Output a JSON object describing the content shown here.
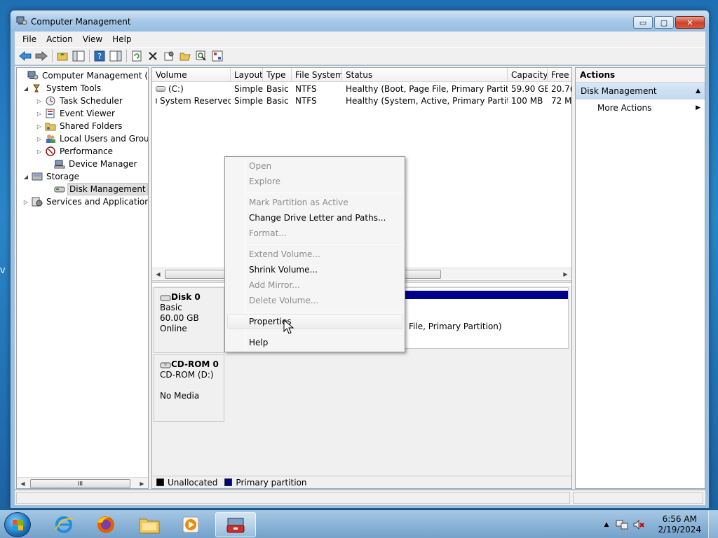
{
  "window": {
    "title": "Computer Management",
    "controls": {
      "minimize": "▭",
      "maximize": "▢",
      "close": "✕"
    }
  },
  "menu": [
    "File",
    "Action",
    "View",
    "Help"
  ],
  "tree": {
    "items": [
      {
        "label": "Computer Management (Local",
        "arrow": "",
        "icon": "computer-management-icon"
      },
      {
        "label": "System Tools",
        "arrow": "◢",
        "icon": "system-tools-icon"
      },
      {
        "label": "Task Scheduler",
        "arrow": "▷",
        "icon": "task-scheduler-icon"
      },
      {
        "label": "Event Viewer",
        "arrow": "▷",
        "icon": "event-viewer-icon"
      },
      {
        "label": "Shared Folders",
        "arrow": "▷",
        "icon": "shared-folders-icon"
      },
      {
        "label": "Local Users and Groups",
        "arrow": "▷",
        "icon": "local-users-icon"
      },
      {
        "label": "Performance",
        "arrow": "▷",
        "icon": "performance-icon"
      },
      {
        "label": "Device Manager",
        "arrow": "",
        "icon": "device-manager-icon"
      },
      {
        "label": "Storage",
        "arrow": "◢",
        "icon": "storage-icon"
      },
      {
        "label": "Disk Management",
        "arrow": "",
        "icon": "disk-management-icon"
      },
      {
        "label": "Services and Applications",
        "arrow": "▷",
        "icon": "services-icon"
      }
    ],
    "scroll_grip": "III"
  },
  "volume_list": {
    "columns": [
      "Volume",
      "Layout",
      "Type",
      "File System",
      "Status",
      "Capacity",
      "Free"
    ],
    "rows": [
      [
        "(C:)",
        "Simple",
        "Basic",
        "NTFS",
        "Healthy (Boot, Page File, Primary Partition)",
        "59.90 GB",
        "20.7("
      ],
      [
        "System Reserved",
        "Simple",
        "Basic",
        "NTFS",
        "Healthy (System, Active, Primary Partition)",
        "100 MB",
        "72 M"
      ]
    ]
  },
  "disks": [
    {
      "name": "Disk 0",
      "lines": [
        "Basic",
        "60.00 GB",
        "Online"
      ],
      "partition_status": "File, Primary Partition)"
    },
    {
      "name": "CD-ROM 0",
      "lines": [
        "CD-ROM (D:)",
        "",
        "No Media"
      ]
    }
  ],
  "legend": {
    "unallocated": "Unallocated",
    "primary": "Primary partition",
    "unallocated_color": "#000000",
    "primary_color": "#00008b"
  },
  "actions": {
    "header": "Actions",
    "section": "Disk Management",
    "more": "More Actions",
    "collapse_glyph": "▲",
    "submenu_glyph": "▶"
  },
  "context_menu": {
    "items": [
      {
        "label": "Open",
        "disabled": true
      },
      {
        "label": "Explore",
        "disabled": true
      },
      {
        "label": "Mark Partition as Active",
        "disabled": true
      },
      {
        "label": "Change Drive Letter and Paths...",
        "disabled": false
      },
      {
        "label": "Format...",
        "disabled": true
      },
      {
        "label": "Extend Volume...",
        "disabled": true
      },
      {
        "label": "Shrink Volume...",
        "disabled": false
      },
      {
        "label": "Add Mirror...",
        "disabled": true
      },
      {
        "label": "Delete Volume...",
        "disabled": true
      },
      {
        "label": "Properties",
        "disabled": false,
        "hovered": true
      },
      {
        "label": "Help",
        "disabled": false
      }
    ]
  },
  "taskbar": {
    "apps": [
      "internet-explorer-icon",
      "firefox-icon",
      "file-explorer-icon",
      "media-player-icon",
      "computer-management-taskbar-icon"
    ],
    "clock": {
      "time": "6:56 AM",
      "date": "2/19/2024"
    },
    "tray_glyph": "▲"
  }
}
